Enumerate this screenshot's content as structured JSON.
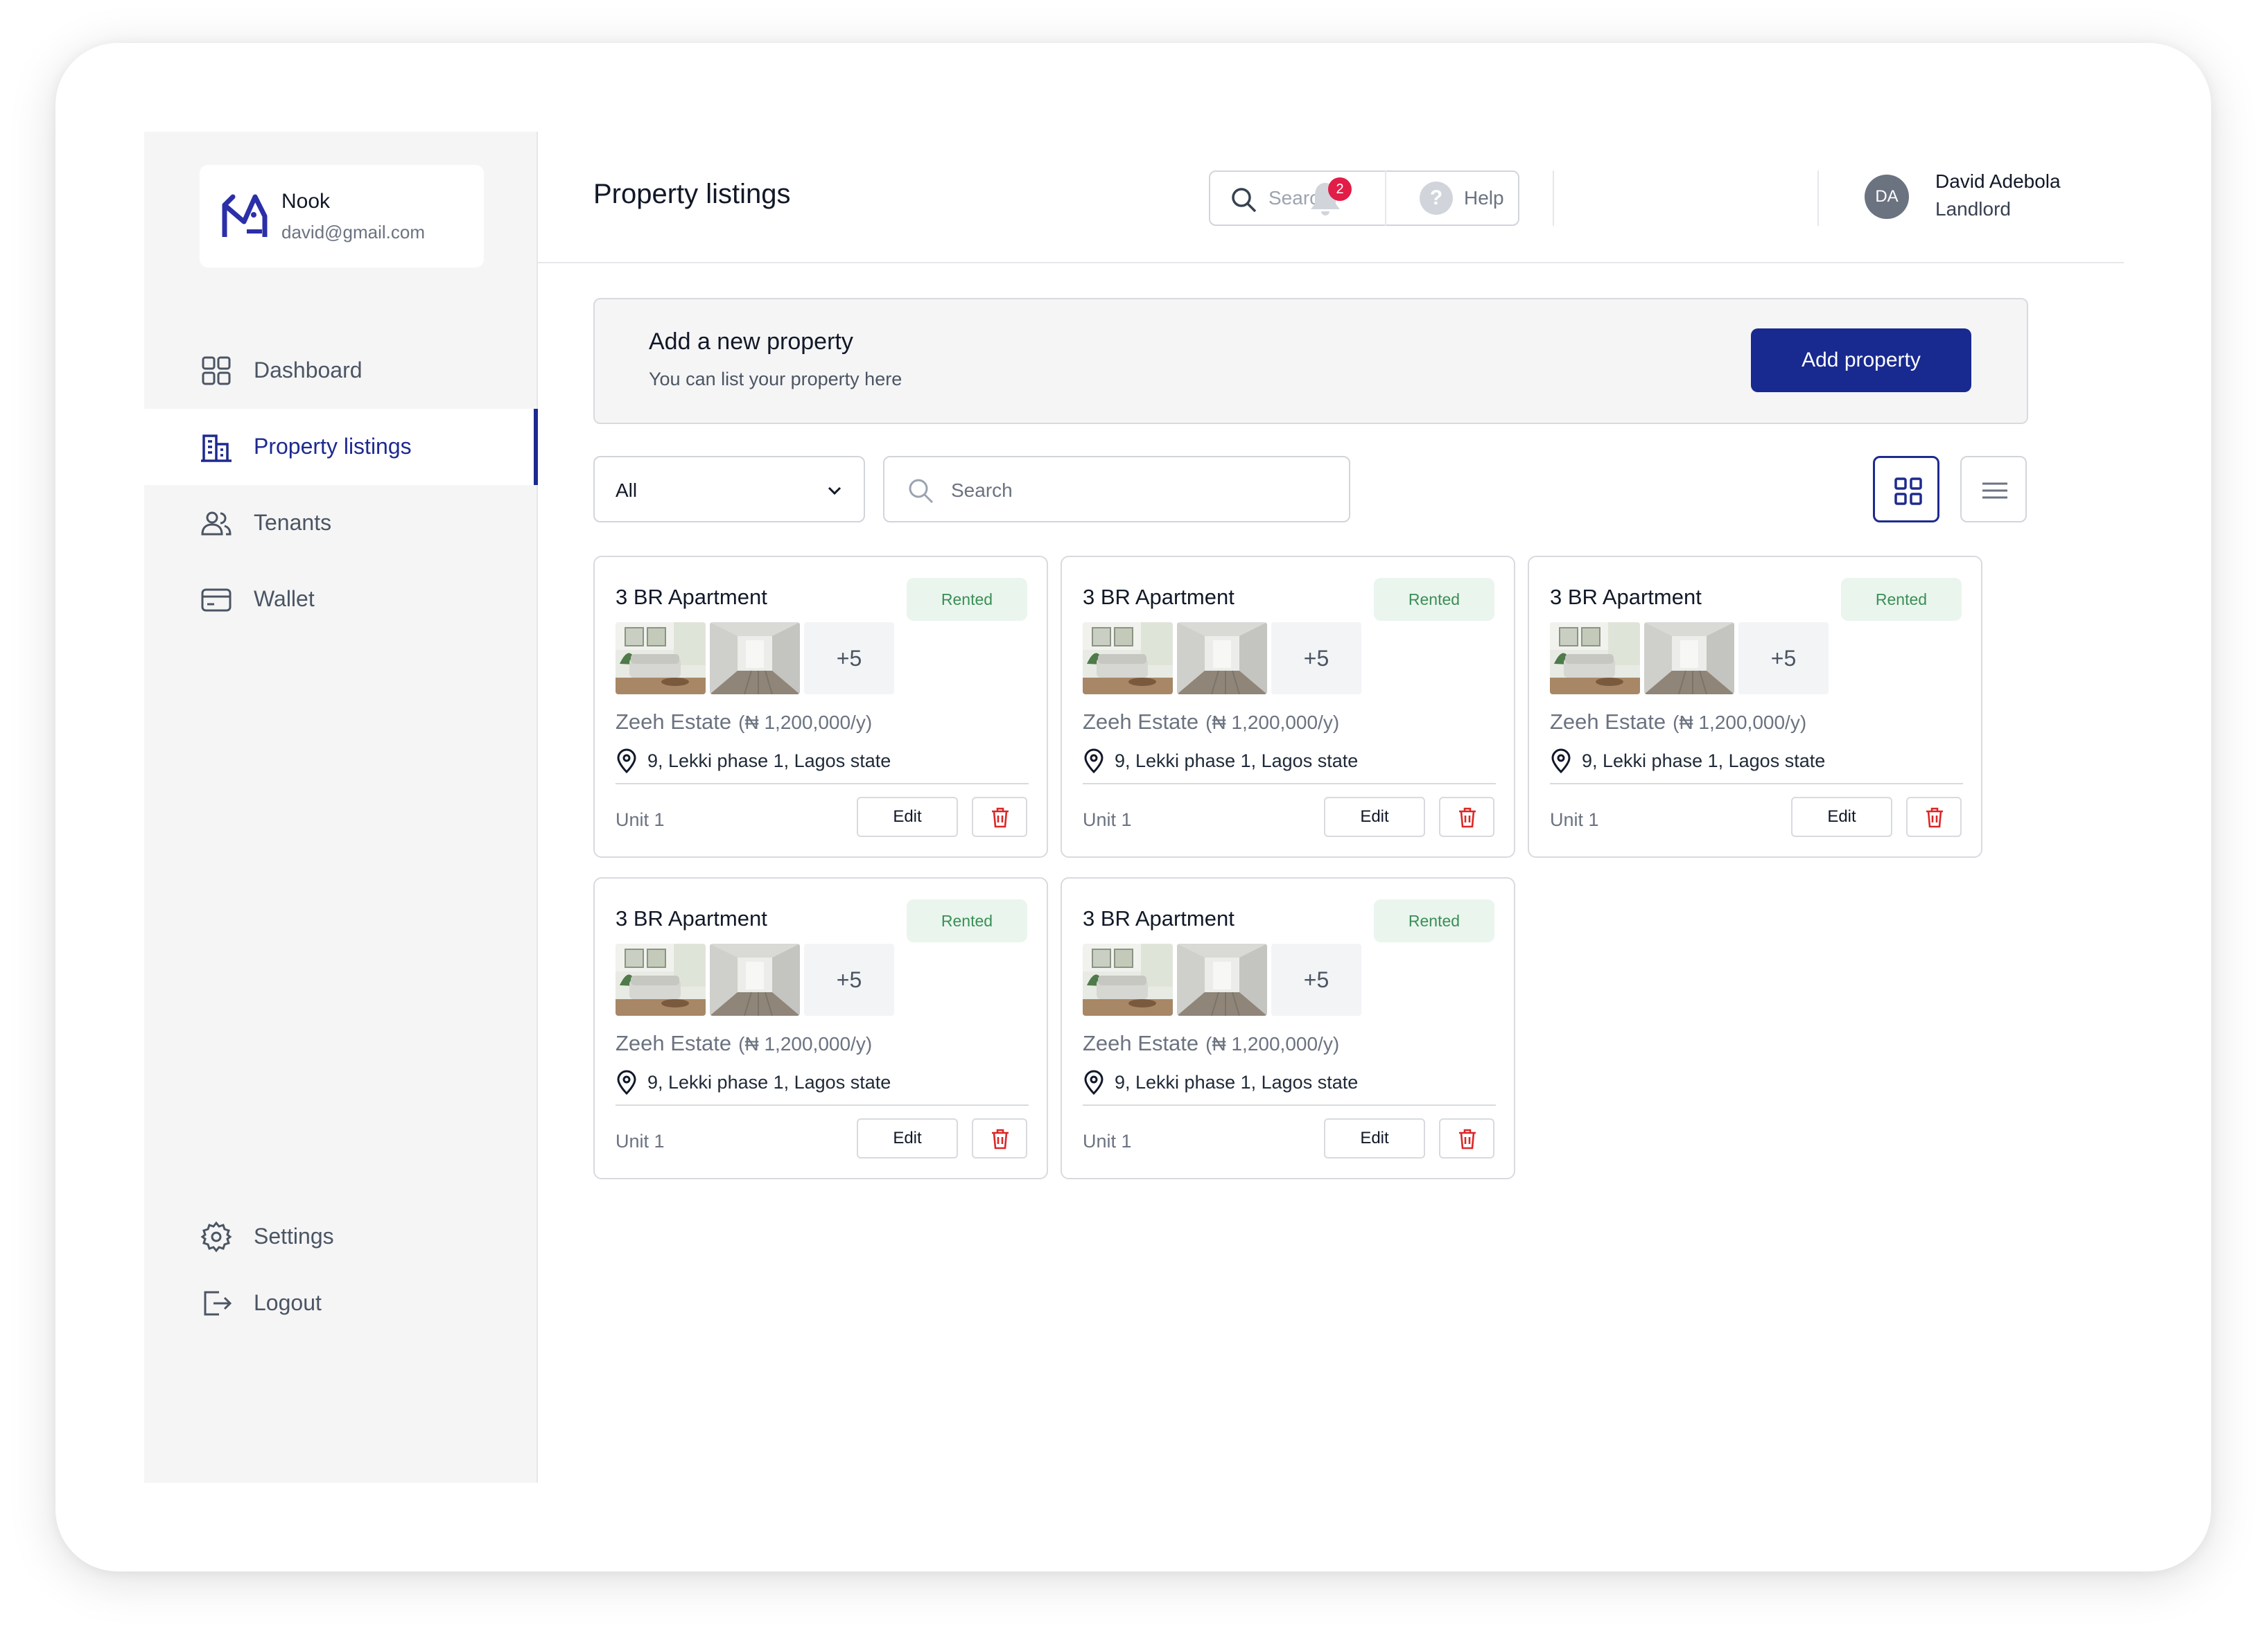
{
  "sidebar": {
    "brand": {
      "name": "Nook",
      "email": "david@gmail.com",
      "icon": "house-logo-icon"
    },
    "items": [
      {
        "label": "Dashboard",
        "icon": "grid-icon",
        "active": false
      },
      {
        "label": "Property listings",
        "icon": "building-icon",
        "active": true
      },
      {
        "label": "Tenants",
        "icon": "users-icon",
        "active": false
      },
      {
        "label": "Wallet",
        "icon": "card-icon",
        "active": false
      }
    ],
    "bottom_items": [
      {
        "label": "Settings",
        "icon": "gear-icon"
      },
      {
        "label": "Logout",
        "icon": "logout-icon"
      }
    ]
  },
  "header": {
    "title": "Property listings",
    "search_placeholder": "Search",
    "notification_count": "2",
    "help_label": "Help",
    "user": {
      "initials": "DA",
      "name": "David Adebola",
      "role": "Landlord"
    }
  },
  "banner": {
    "title": "Add a new property",
    "subtitle": "You can list your property here",
    "button_label": "Add property"
  },
  "filters": {
    "selected": "All",
    "search_placeholder": "Search",
    "view_mode": "grid"
  },
  "cards": [
    {
      "title": "3 BR Apartment",
      "status": "Rented",
      "extra_photos": "+5",
      "estate": "Zeeh Estate",
      "price": "(₦ 1,200,000/y)",
      "address": "9, Lekki phase 1, Lagos state",
      "unit": "Unit 1",
      "edit_label": "Edit"
    },
    {
      "title": "3 BR Apartment",
      "status": "Rented",
      "extra_photos": "+5",
      "estate": "Zeeh Estate",
      "price": "(₦ 1,200,000/y)",
      "address": "9, Lekki phase 1, Lagos state",
      "unit": "Unit 1",
      "edit_label": "Edit"
    },
    {
      "title": "3 BR Apartment",
      "status": "Rented",
      "extra_photos": "+5",
      "estate": "Zeeh Estate",
      "price": "(₦ 1,200,000/y)",
      "address": "9, Lekki phase 1, Lagos state",
      "unit": "Unit 1",
      "edit_label": "Edit"
    },
    {
      "title": "3 BR Apartment",
      "status": "Rented",
      "extra_photos": "+5",
      "estate": "Zeeh Estate",
      "price": "(₦ 1,200,000/y)",
      "address": "9, Lekki phase 1, Lagos state",
      "unit": "Unit 1",
      "edit_label": "Edit"
    },
    {
      "title": "3 BR Apartment",
      "status": "Rented",
      "extra_photos": "+5",
      "estate": "Zeeh Estate",
      "price": "(₦ 1,200,000/y)",
      "address": "9, Lekki phase 1, Lagos state",
      "unit": "Unit 1",
      "edit_label": "Edit"
    }
  ],
  "colors": {
    "accent": "#18298f",
    "status_green": "#3a8f55",
    "status_bg": "#eaf5ee",
    "danger": "#dc2626",
    "badge": "#e11d48"
  }
}
